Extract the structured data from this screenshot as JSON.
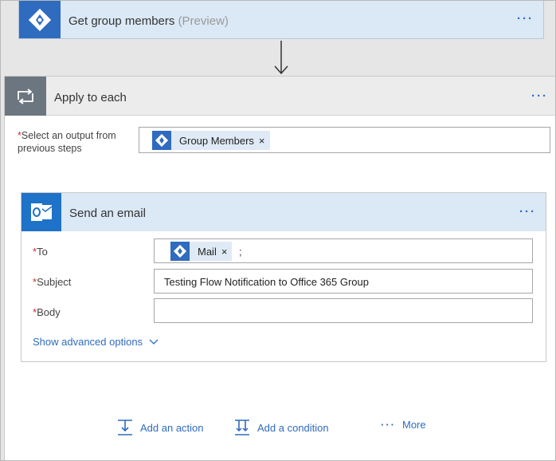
{
  "top_card": {
    "title": "Get group members",
    "subtitle": "(Preview)",
    "menu": "···"
  },
  "apply": {
    "title": "Apply to each",
    "menu": "···",
    "output_label": "Select an output from previous steps",
    "required_mark": "*",
    "token": {
      "label": "Group Members",
      "remove": "×"
    }
  },
  "email": {
    "title": "Send an email",
    "menu": "···",
    "to_label": "To",
    "to_token": {
      "label": "Mail",
      "remove": "×"
    },
    "to_separator": ";",
    "subject_label": "Subject",
    "subject_value": "Testing Flow Notification to Office 365 Group",
    "body_label": "Body",
    "body_value": "",
    "show_advanced": "Show advanced options"
  },
  "footer": {
    "add_action": "Add an action",
    "add_condition": "Add a condition",
    "more": "More",
    "more_dots": "···"
  },
  "colors": {
    "accent": "#2f6bbf",
    "card_header": "#dbe8f5",
    "required": "#c8302a"
  }
}
